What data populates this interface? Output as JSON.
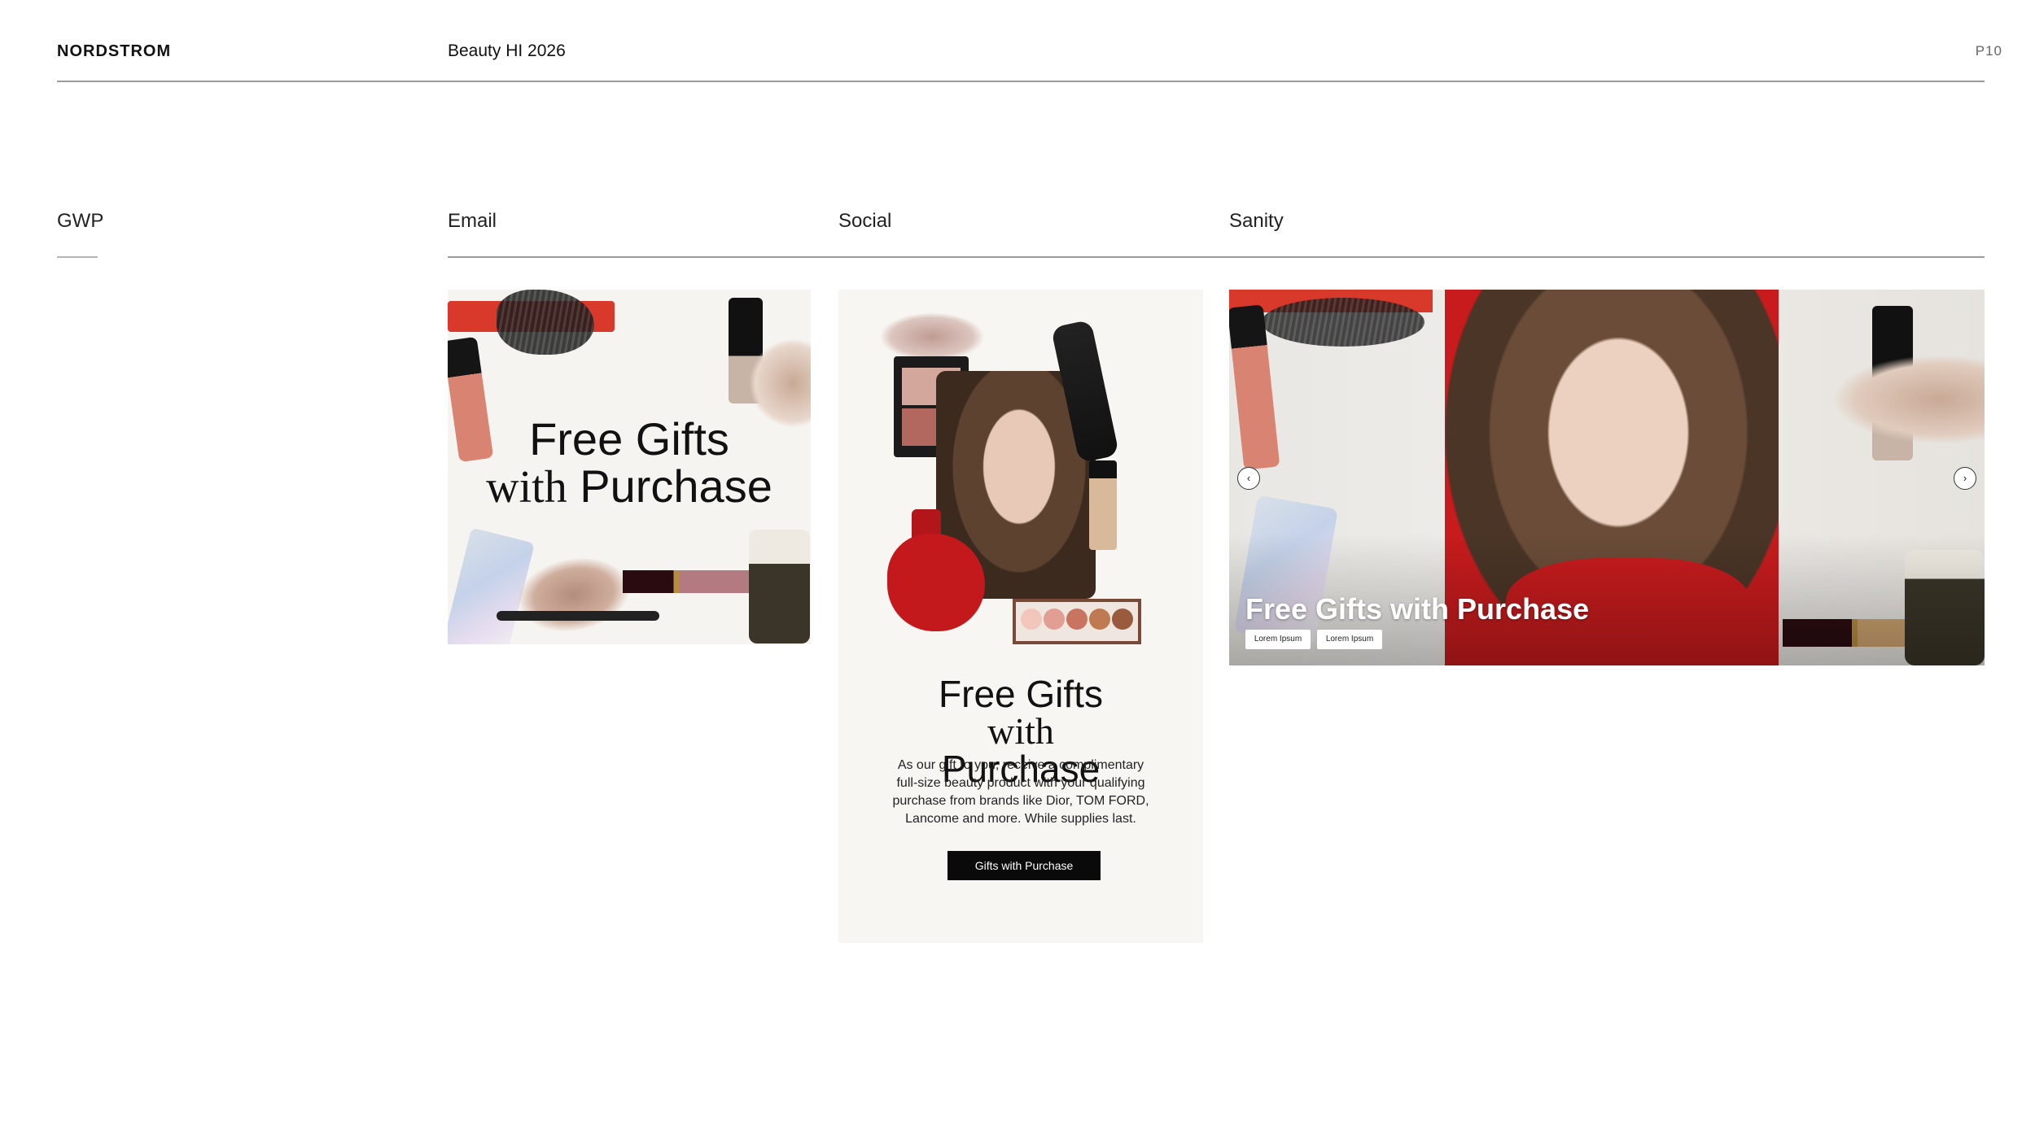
{
  "header": {
    "brand": "NORDSTROM",
    "project": "Beauty HI 2026",
    "page_number": "P10"
  },
  "sections": {
    "gwp": "GWP",
    "email": "Email",
    "social": "Social",
    "sanity": "Sanity"
  },
  "email": {
    "title_line1": "Free Gifts",
    "title_line2_serif": "with",
    "title_line2_sans": "Purchase"
  },
  "social": {
    "title_line1": "Free Gifts",
    "title_line2_serif": "with",
    "title_line2_sans": "Purchase",
    "body": "As our gift to you, receive a complimentary full-size beauty product with your qualifying purchase from brands like Dior, TOM FORD, Lancome and more. While supplies last.",
    "cta": "Gifts with Purchase"
  },
  "sanity": {
    "title": "Free Gifts with Purchase",
    "pill_1": "Lorem Ipsum",
    "pill_2": "Lorem Ipsum",
    "prev": "‹",
    "next": "›"
  },
  "icons": [
    "chevron-left-icon",
    "chevron-right-icon"
  ],
  "colors": {
    "accent_red": "#d33a2c",
    "cta_black": "#0a0a0a",
    "card_bg": "#f6f4f0"
  }
}
